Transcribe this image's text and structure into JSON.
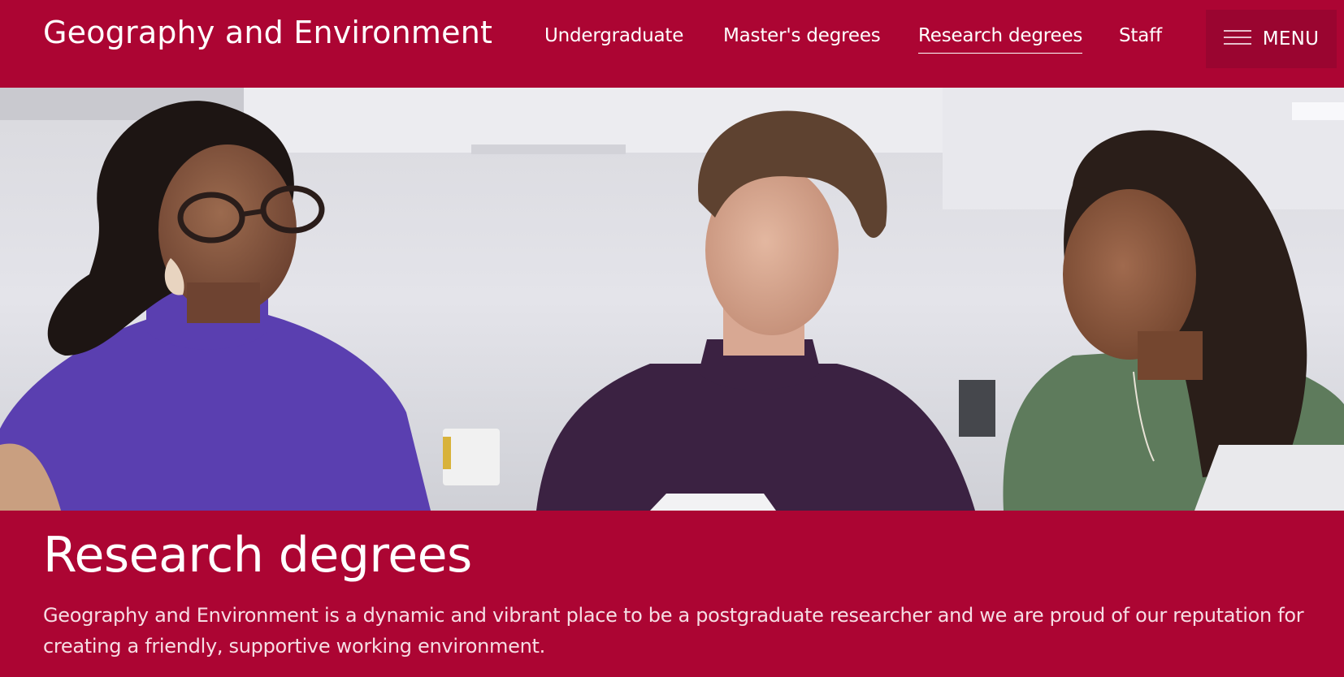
{
  "header": {
    "site_title": "Geography and Environment",
    "nav": [
      {
        "label": "Undergraduate",
        "active": false
      },
      {
        "label": "Master's degrees",
        "active": false
      },
      {
        "label": "Research degrees",
        "active": true
      },
      {
        "label": "Staff",
        "active": false
      }
    ],
    "menu_label": "MENU",
    "menu_icon": "hamburger-icon"
  },
  "hero": {
    "image": "photo-of-three-postgraduate-students-talking-in-a-lab"
  },
  "intro": {
    "heading": "Research degrees",
    "text": "Geography and Environment is a dynamic and vibrant place to be a postgraduate researcher and we are proud of our reputation for creating a friendly, supportive working environment."
  },
  "colors": {
    "brand": "#ac0533",
    "menu_bg": "#9a0530",
    "text": "#ffffff"
  }
}
